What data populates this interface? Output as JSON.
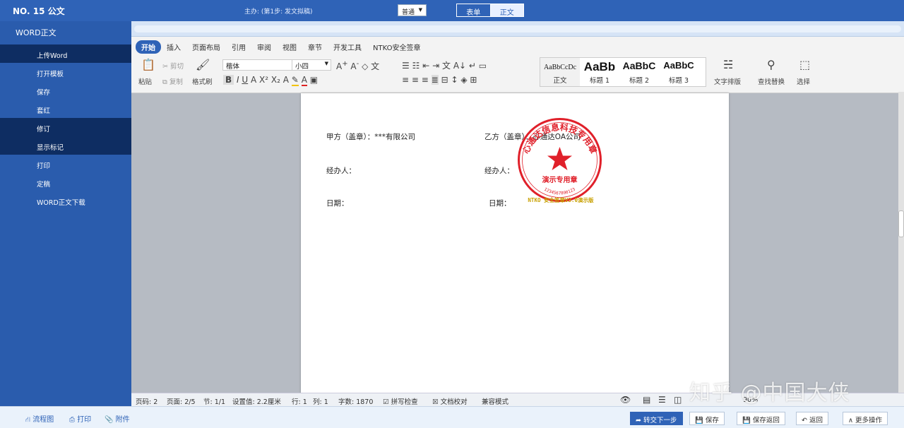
{
  "topbar": {
    "doc_no": "NO. 15 公文",
    "step": "主办: (第1步: 发文拟稿)",
    "select_value": "普通",
    "tabs": [
      "表单",
      "正文"
    ]
  },
  "sidebar": {
    "title": "WORD正文",
    "items": [
      "上传Word",
      "打开模板",
      "保存",
      "套红",
      "修订",
      "显示标记",
      "打印",
      "定稿",
      "WORD正文下载"
    ]
  },
  "ribbon": {
    "tabs": [
      "开始",
      "插入",
      "页面布局",
      "引用",
      "审阅",
      "视图",
      "章节",
      "开发工具",
      "NTKO安全签章"
    ],
    "paste": "粘贴",
    "cut": "剪切",
    "copy": "复制",
    "format_painter": "格式刷",
    "font_name": "楷体",
    "font_size": "小四",
    "styles": [
      {
        "preview": "AaBbCcDc",
        "name": "正文"
      },
      {
        "preview": "AaBb",
        "name": "标题 1"
      },
      {
        "preview": "AaBbC",
        "name": "标题 2"
      },
      {
        "preview": "AaBbC",
        "name": "标题 3"
      }
    ],
    "text_layout": "文字排版",
    "find_replace": "查找替换",
    "select": "选择"
  },
  "document": {
    "party_a": "甲方（盖章）：***有限公司",
    "party_b": "乙方（盖章）：心通达OA公司",
    "handler_a": "经办人：",
    "handler_b": "经办人：",
    "date_a": "日期：",
    "date_b": "日期：",
    "stamp_ring": "心通达信息科技专用章",
    "stamp_label": "演示专用章",
    "stamp_code": "1234567890123",
    "stamp_caption": "NTKO 安全签章V3.0演示版"
  },
  "statusbar": {
    "page_code": "页码: 2",
    "pages": "页面: 2/5",
    "section": "节: 1/1",
    "setting": "设置值: 2.2厘米",
    "row": "行: 1",
    "col": "列: 1",
    "words": "字数: 1870",
    "spell": "拼写检查",
    "proof": "文档校对",
    "compat": "兼容模式",
    "zoom": "90%"
  },
  "bottombar": {
    "flow": "流程图",
    "print": "打印",
    "attach": "附件",
    "next": "转交下一步",
    "save": "保存",
    "save_back": "保存返回",
    "back": "返回",
    "more": "更多操作"
  },
  "watermark": "知乎 @中国大侠",
  "colors": {
    "brand": "#2f63b7",
    "sidebar_dark": "#0e2d62",
    "stamp": "#e0202a"
  }
}
